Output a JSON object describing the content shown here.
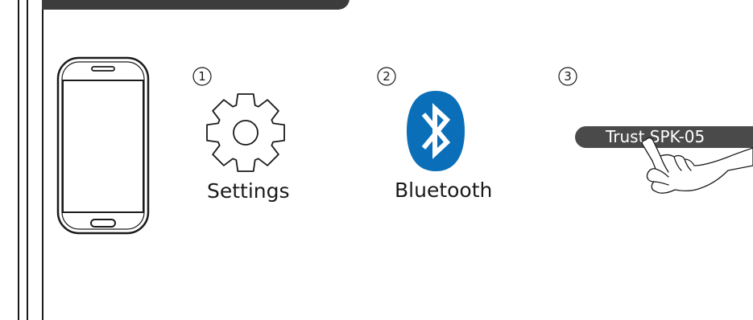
{
  "steps": [
    {
      "number": "1",
      "label": "Settings",
      "icon": "gear-icon"
    },
    {
      "number": "2",
      "label": "Bluetooth",
      "icon": "bluetooth-icon"
    },
    {
      "number": "3",
      "label": "",
      "icon": "hand-pointer-icon"
    }
  ],
  "device": {
    "name": "Trust SPK-05"
  },
  "colors": {
    "bluetooth_blue": "#0a6fb8",
    "header_tab": "#3c3c3c",
    "device_pill": "#4a4a4a",
    "line": "#1a1a1a"
  }
}
